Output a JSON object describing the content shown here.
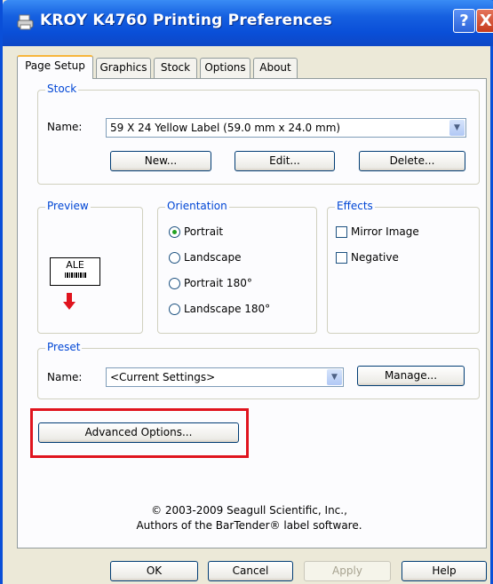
{
  "window": {
    "title": "KROY K4760 Printing Preferences",
    "help_glyph": "?",
    "close_glyph": "X"
  },
  "tabs": [
    {
      "label": "Page Setup",
      "active": true
    },
    {
      "label": "Graphics",
      "active": false
    },
    {
      "label": "Stock",
      "active": false
    },
    {
      "label": "Options",
      "active": false
    },
    {
      "label": "About",
      "active": false
    }
  ],
  "stock": {
    "legend": "Stock",
    "name_label": "Name:",
    "name_value": "59 X 24 Yellow Label (59.0 mm x 24.0 mm)",
    "new_button": "New...",
    "edit_button": "Edit...",
    "delete_button": "Delete..."
  },
  "preview": {
    "legend": "Preview",
    "label_text": "ALE",
    "arrow_color": "#e0141e"
  },
  "orientation": {
    "legend": "Orientation",
    "options": [
      {
        "label": "Portrait",
        "selected": true
      },
      {
        "label": "Landscape",
        "selected": false
      },
      {
        "label": "Portrait 180°",
        "selected": false
      },
      {
        "label": "Landscape 180°",
        "selected": false
      }
    ]
  },
  "effects": {
    "legend": "Effects",
    "options": [
      {
        "label": "Mirror Image",
        "checked": false
      },
      {
        "label": "Negative",
        "checked": false
      }
    ]
  },
  "preset": {
    "legend": "Preset",
    "name_label": "Name:",
    "name_value": "<Current Settings>",
    "manage_button": "Manage..."
  },
  "advanced_button": "Advanced Options...",
  "copyright": {
    "line1": "© 2003-2009 Seagull Scientific, Inc.,",
    "line2": "Authors of the BarTender® label software."
  },
  "footer": {
    "ok": "OK",
    "cancel": "Cancel",
    "apply": "Apply",
    "help": "Help"
  },
  "colors": {
    "title_bar": "#0a4fd8",
    "group_legend": "#0046d5",
    "highlight_box": "#e0141e",
    "radio_dot": "#21a121"
  }
}
